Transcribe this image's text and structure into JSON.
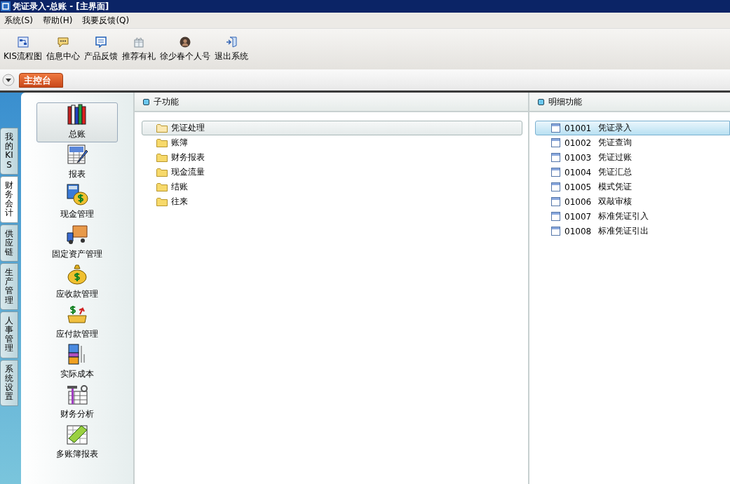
{
  "window": {
    "title": "凭证录入-总账 - [主界面]"
  },
  "menu": [
    "系统(S)",
    "帮助(H)",
    "我要反馈(Q)"
  ],
  "toolbar": [
    {
      "kind": "flow",
      "label": "KIS流程图"
    },
    {
      "kind": "message",
      "label": "信息中心"
    },
    {
      "kind": "feedback",
      "label": "产品反馈"
    },
    {
      "kind": "gift",
      "label": "推荐有礼"
    },
    {
      "kind": "avatar",
      "label": "徐少春个人号"
    },
    {
      "kind": "exit",
      "label": "退出系统"
    }
  ],
  "console_tab": {
    "label": "主控台"
  },
  "side_tabs": [
    {
      "label": "我的KIS",
      "selected": false
    },
    {
      "label": "财务会计",
      "selected": true
    },
    {
      "label": "供应链",
      "selected": false
    },
    {
      "label": "生产管理",
      "selected": false
    },
    {
      "label": "人事管理",
      "selected": false
    },
    {
      "label": "系统设置",
      "selected": false
    }
  ],
  "modules": [
    {
      "kind": "books",
      "label": "总账",
      "selected": true
    },
    {
      "kind": "report",
      "label": "报表",
      "selected": false
    },
    {
      "kind": "cash",
      "label": "现金管理",
      "selected": false
    },
    {
      "kind": "truck",
      "label": "固定资产管理",
      "selected": false
    },
    {
      "kind": "bag",
      "label": "应收款管理",
      "selected": false
    },
    {
      "kind": "pay",
      "label": "应付款管理",
      "selected": false
    },
    {
      "kind": "cost",
      "label": "实际成本",
      "selected": false
    },
    {
      "kind": "analysis",
      "label": "财务分析",
      "selected": false
    },
    {
      "kind": "money",
      "label": "多账簿报表",
      "selected": false
    }
  ],
  "sub_functions": {
    "title": "子功能",
    "items": [
      {
        "label": "凭证处理",
        "selected": true
      },
      {
        "label": "账簿",
        "selected": false
      },
      {
        "label": "财务报表",
        "selected": false
      },
      {
        "label": "现金流量",
        "selected": false
      },
      {
        "label": "结账",
        "selected": false
      },
      {
        "label": "往来",
        "selected": false
      }
    ]
  },
  "detail_functions": {
    "title": "明细功能",
    "items": [
      {
        "code": "01001",
        "label": "凭证录入",
        "selected": true
      },
      {
        "code": "01002",
        "label": "凭证查询",
        "selected": false
      },
      {
        "code": "01003",
        "label": "凭证过账",
        "selected": false
      },
      {
        "code": "01004",
        "label": "凭证汇总",
        "selected": false
      },
      {
        "code": "01005",
        "label": "模式凭证",
        "selected": false
      },
      {
        "code": "01006",
        "label": "双敲审核",
        "selected": false
      },
      {
        "code": "01007",
        "label": "标准凭证引入",
        "selected": false
      },
      {
        "code": "01008",
        "label": "标准凭证引出",
        "selected": false
      }
    ]
  }
}
